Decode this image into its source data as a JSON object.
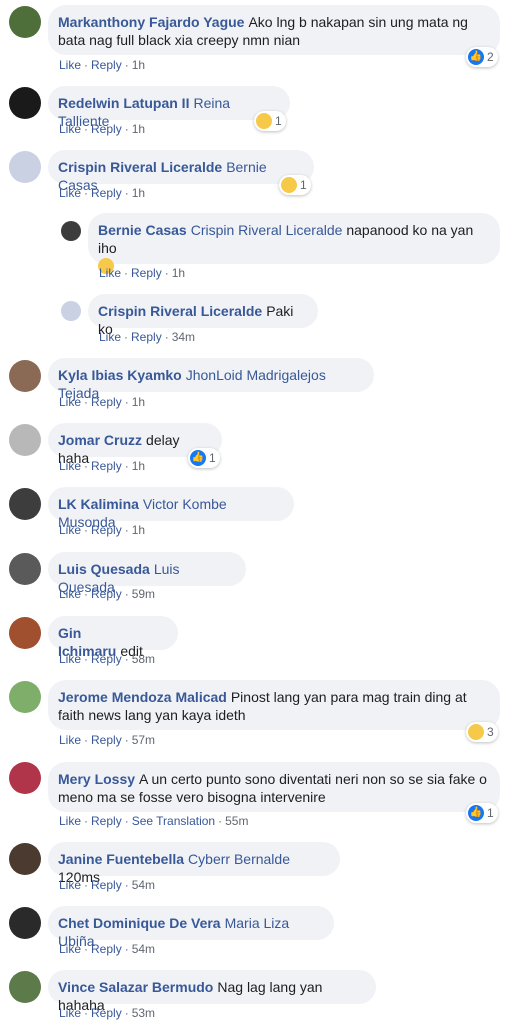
{
  "comments": [
    {
      "author": "Markanthony Fajardo Yague",
      "text": "Ako lng b nakapan sin ung mata ng bata nag full black xia creepy nmn nian",
      "like": "Like",
      "reply": "Reply",
      "time": "1h",
      "reaction_count": "2",
      "reaction_icon": "like-icon"
    },
    {
      "author": "Redelwin Latupan II",
      "mention": "Reina Talliente",
      "like": "Like",
      "reply": "Reply",
      "time": "1h",
      "reaction_count": "1",
      "reaction_icon": "sad-icon"
    },
    {
      "author": "Crispin Riveral Liceralde",
      "mention": "Bernie Casas",
      "like": "Like",
      "reply": "Reply",
      "time": "1h",
      "reaction_count": "1",
      "reaction_icon": "haha-icon"
    },
    {
      "author": "Bernie Casas",
      "mention": "Crispin Riveral Liceralde",
      "text": "napanood ko na yan iho",
      "like": "Like",
      "reply": "Reply",
      "time": "1h"
    },
    {
      "author": "Crispin Riveral Liceralde",
      "text": "Paki ko",
      "like": "Like",
      "reply": "Reply",
      "time": "34m"
    },
    {
      "author": "Kyla Ibias Kyamko",
      "mention": "JhonLoid Madrigalejos Tejada",
      "like": "Like",
      "reply": "Reply",
      "time": "1h"
    },
    {
      "author": "Jomar Cruzz",
      "text": "delay haha",
      "like": "Like",
      "reply": "Reply",
      "time": "1h",
      "reaction_count": "1",
      "reaction_icon": "like-icon"
    },
    {
      "author": "LK Kalimina",
      "mention": "Victor Kombe Musonda",
      "like": "Like",
      "reply": "Reply",
      "time": "1h"
    },
    {
      "author": "Luis Quesada",
      "mention": "Luis Quesada",
      "like": "Like",
      "reply": "Reply",
      "time": "59m"
    },
    {
      "author": "Gin Ichimaru",
      "text": "edit",
      "like": "Like",
      "reply": "Reply",
      "time": "58m"
    },
    {
      "author": "Jerome Mendoza Malicad",
      "text": "Pinost lang yan para mag train ding at faith news lang yan kaya ideth",
      "like": "Like",
      "reply": "Reply",
      "time": "57m",
      "reaction_count": "3",
      "reaction_icon": "haha-icon"
    },
    {
      "author": "Mery Lossy",
      "text": "A un certo punto sono diventati neri non so se sia fake o meno ma se fosse vero bisogna intervenire",
      "like": "Like",
      "reply": "Reply",
      "see_translation": "See Translation",
      "time": "55m",
      "reaction_count": "1",
      "reaction_icon": "like-icon"
    },
    {
      "author": "Janine Fuentebella",
      "mention": "Cyberr Bernalde",
      "text": "120ms",
      "like": "Like",
      "reply": "Reply",
      "time": "54m"
    },
    {
      "author": "Chet Dominique De Vera",
      "mention": "Maria Liza Ubiña",
      "like": "Like",
      "reply": "Reply",
      "time": "54m"
    },
    {
      "author": "Vince Salazar Bermudo",
      "text": "Nag lag lang yan hahaha",
      "like": "Like",
      "reply": "Reply",
      "time": "53m"
    }
  ],
  "colors": {
    "link": "#385898",
    "bubble": "#f0f2f5",
    "meta": "#606770",
    "like_blue": "#1877f2",
    "emoji_yellow": "#f7c948"
  }
}
